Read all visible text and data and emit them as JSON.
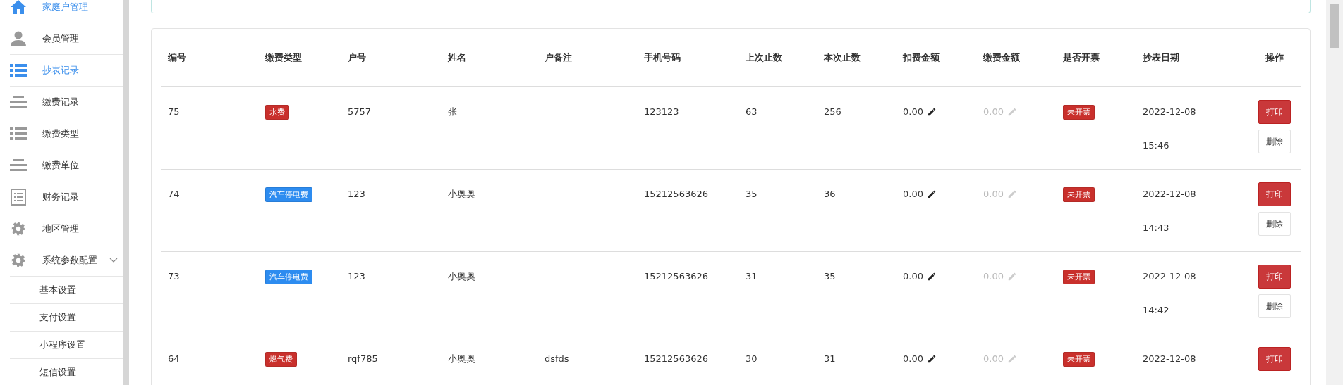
{
  "sidebar": {
    "items": [
      {
        "label": "家庭户管理",
        "kind": "home",
        "selected": true
      },
      {
        "label": "会员管理",
        "kind": "user",
        "selected": false
      },
      {
        "label": "抄表记录",
        "kind": "list",
        "selected": true
      },
      {
        "label": "缴费记录",
        "kind": "lines",
        "selected": false
      },
      {
        "label": "缴费类型",
        "kind": "list",
        "selected": false
      },
      {
        "label": "缴费单位",
        "kind": "lines",
        "selected": false
      },
      {
        "label": "财务记录",
        "kind": "form",
        "selected": false
      },
      {
        "label": "地区管理",
        "kind": "gear",
        "selected": false
      },
      {
        "label": "系统参数配置",
        "kind": "gear",
        "selected": false,
        "expanded": true,
        "children": [
          {
            "label": "基本设置",
            "selected": false
          },
          {
            "label": "支付设置",
            "selected": false
          },
          {
            "label": "小程序设置",
            "selected": false
          },
          {
            "label": "短信设置",
            "selected": false
          }
        ]
      }
    ]
  },
  "table": {
    "columns": [
      "编号",
      "缴费类型",
      "户号",
      "姓名",
      "户备注",
      "手机号码",
      "上次止数",
      "本次止数",
      "扣费金额",
      "缴费金额",
      "是否开票",
      "抄表日期",
      "操作"
    ],
    "rows": [
      {
        "id": "75",
        "fee_type": {
          "label": "水费",
          "color": "#c9302c"
        },
        "account": "5757",
        "name": "张",
        "note": "",
        "phone": "123123",
        "previous": "63",
        "current": "256",
        "deduction": {
          "value": "0.00",
          "disabled": false
        },
        "payment": {
          "value": "0.00",
          "disabled": true
        },
        "invoice": "未开票",
        "date": "2022-12-08",
        "time": "15:46",
        "buttons": [
          "打印",
          "删除"
        ]
      },
      {
        "id": "74",
        "fee_type": {
          "label": "汽车停电费",
          "color": "#2d8cf0"
        },
        "account": "123",
        "name": "小奥奥",
        "note": "",
        "phone": "15212563626",
        "previous": "35",
        "current": "36",
        "deduction": {
          "value": "0.00",
          "disabled": false
        },
        "payment": {
          "value": "0.00",
          "disabled": true
        },
        "invoice": "未开票",
        "date": "2022-12-08",
        "time": "14:43",
        "buttons": [
          "打印",
          "删除"
        ]
      },
      {
        "id": "73",
        "fee_type": {
          "label": "汽车停电费",
          "color": "#2d8cf0"
        },
        "account": "123",
        "name": "小奥奥",
        "note": "",
        "phone": "15212563626",
        "previous": "31",
        "current": "35",
        "deduction": {
          "value": "0.00",
          "disabled": false
        },
        "payment": {
          "value": "0.00",
          "disabled": true
        },
        "invoice": "未开票",
        "date": "2022-12-08",
        "time": "14:42",
        "buttons": [
          "打印",
          "删除"
        ]
      },
      {
        "id": "64",
        "fee_type": {
          "label": "燃气费",
          "color": "#c9302c"
        },
        "account": "rqf785",
        "name": "小奥奥",
        "note": "dsfds",
        "phone": "15212563626",
        "previous": "30",
        "current": "31",
        "deduction": {
          "value": "0.00",
          "disabled": false
        },
        "payment": {
          "value": "0.00",
          "disabled": true
        },
        "invoice": "未开票",
        "date": "2022-12-08",
        "buttons": [
          "打印"
        ]
      }
    ]
  }
}
